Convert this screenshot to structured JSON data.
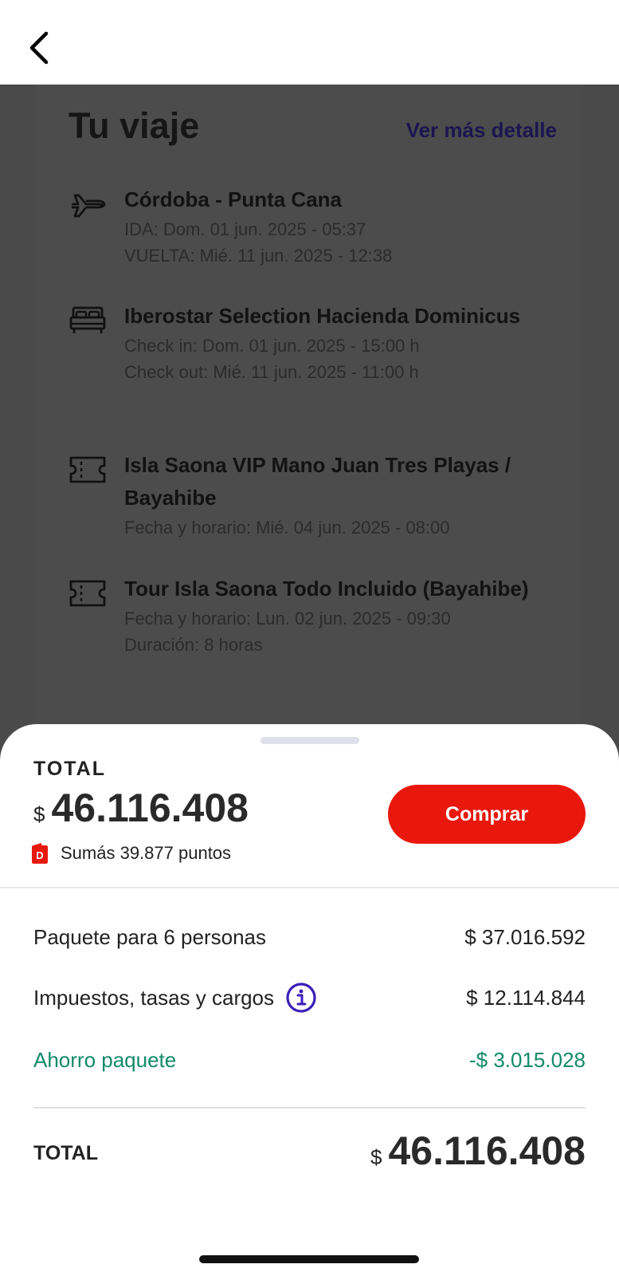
{
  "header": {
    "back_icon": "chevron-left-icon"
  },
  "trip": {
    "title": "Tu viaje",
    "detail_link": "Ver más detalle",
    "items": [
      {
        "icon": "plane-icon",
        "name": "Córdoba - Punta Cana",
        "lines": [
          "IDA: Dom. 01 jun. 2025 - 05:37",
          "VUELTA: Mié. 11 jun. 2025 - 12:38"
        ]
      },
      {
        "icon": "bed-icon",
        "name": "Iberostar Selection Hacienda Dominicus",
        "lines": [
          "Check in: Dom. 01 jun. 2025 - 15:00 h",
          "Check out: Mié. 11 jun. 2025 - 11:00 h"
        ]
      },
      {
        "icon": "ticket-icon",
        "name": "Isla Saona VIP Mano Juan Tres Playas / Bayahibe",
        "lines": [
          "Fecha y horario: Mié. 04 jun. 2025 - 08:00"
        ]
      },
      {
        "icon": "ticket-icon",
        "name": "Tour Isla Saona Todo Incluido (Bayahibe)",
        "lines": [
          "Fecha y horario: Lun. 02 jun. 2025 - 09:30",
          "Duración: 8 horas"
        ]
      }
    ]
  },
  "summary": {
    "total_label": "TOTAL",
    "currency": "$",
    "total_value": "46.116.408",
    "points_icon": "points-badge-icon",
    "points_text": "Sumás 39.877 puntos",
    "buy_label": "Comprar",
    "rows": [
      {
        "label": "Paquete para 6 personas",
        "value": "$ 37.016.592"
      },
      {
        "label": "Impuestos, tasas y cargos",
        "value": "$ 12.114.844",
        "info_icon": "info-icon"
      },
      {
        "label": "Ahorro paquete",
        "value": "-$ 3.015.028"
      }
    ],
    "final_label": "TOTAL",
    "final_currency": "$",
    "final_value": "46.116.408"
  },
  "colors": {
    "accent_red": "#e8180c",
    "savings_green": "#128a6b",
    "link_navy": "#1c1550",
    "info_purple": "#3b1fb8"
  }
}
